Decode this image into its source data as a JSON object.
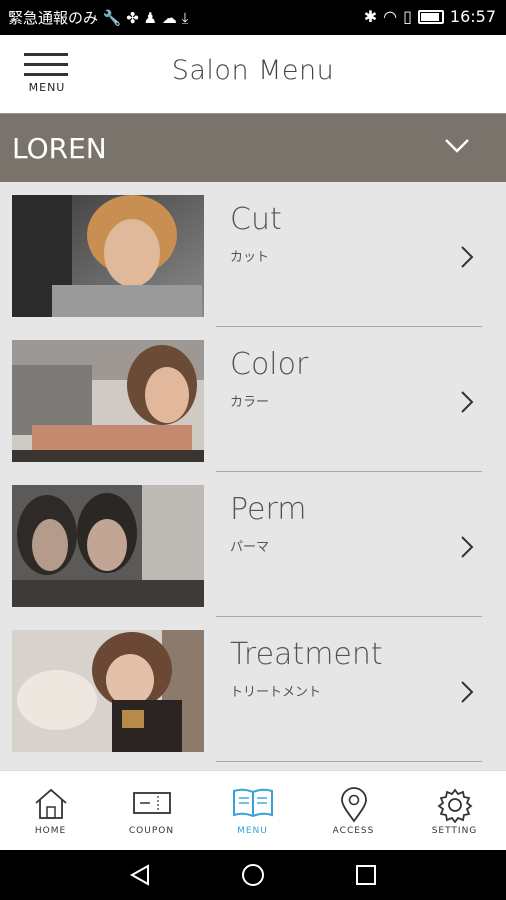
{
  "status_bar": {
    "left_text": "緊急通報のみ",
    "time": "16:57"
  },
  "header": {
    "menu_label": "MENU",
    "title": "Salon Menu"
  },
  "salon_selector": {
    "name": "LOREN"
  },
  "menu_items": [
    {
      "title": "Cut",
      "subtitle": "カット"
    },
    {
      "title": "Color",
      "subtitle": "カラー"
    },
    {
      "title": "Perm",
      "subtitle": "パーマ"
    },
    {
      "title": "Treatment",
      "subtitle": "トリートメント"
    }
  ],
  "tab_bar": {
    "tabs": [
      {
        "label": "HOME",
        "icon": "house-icon"
      },
      {
        "label": "COUPON",
        "icon": "coupon-icon"
      },
      {
        "label": "MENU",
        "icon": "book-icon"
      },
      {
        "label": "ACCESS",
        "icon": "map-pin-icon"
      },
      {
        "label": "SETTING",
        "icon": "gear-icon"
      }
    ],
    "active_color": "#35a3d8"
  },
  "colors": {
    "salon_bar": "#7a736c",
    "list_background": "#e6e6e6"
  }
}
